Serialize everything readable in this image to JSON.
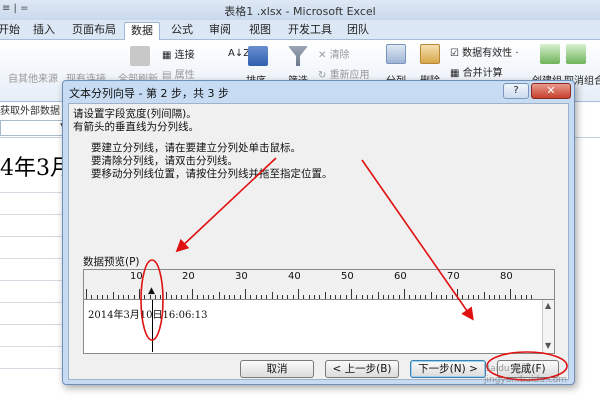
{
  "window": {
    "title": "表格1 .xlsx - Microsoft Excel",
    "quick_access": "≡ | ="
  },
  "menu": {
    "tabs": [
      "开始",
      "插入",
      "页面布局",
      "数据",
      "公式",
      "审阅",
      "视图",
      "开发工具",
      "团队"
    ],
    "active": "数据"
  },
  "ribbon": {
    "get_external": "自其他来源",
    "existing_conn": "现有连接",
    "refresh_all": "全部刷新",
    "connections": "连接",
    "properties": "属性",
    "sort": "排序",
    "filter": "筛选",
    "clear": "清除",
    "reapply": "重新应用",
    "text_to_cols": "分列",
    "remove_dup": "删除",
    "data_validation": "数据有效性 ·",
    "consolidate": "合并计算",
    "group": "创建组",
    "ungroup": "取消组合",
    "group_label": "获取外部数据",
    "sort_az": "A↓Z"
  },
  "sheet": {
    "cell_text": "4年3月"
  },
  "dialog": {
    "title": "文本分列向导 - 第 2 步，共 3 步",
    "help": "?",
    "close": "✕",
    "instructions": [
      "请设置字段宽度(列间隔)。",
      "有箭头的垂直线为分列线。"
    ],
    "steps": [
      "要建立分列线，请在要建立分列处单击鼠标。",
      "要清除分列线，请双击分列线。",
      "要移动分列线位置，请按住分列线并拖至指定位置。"
    ],
    "preview_label": "数据预览(P)",
    "ruler_labels": [
      "10",
      "20",
      "30",
      "40",
      "50",
      "60",
      "70",
      "80"
    ],
    "data_row": "2014年3月10日16:06:13",
    "buttons": {
      "cancel": "取消",
      "back": "< 上一步(B)",
      "next": "下一步(N) >",
      "finish": "完成(F)"
    }
  },
  "watermark": {
    "line1": "Baidu 经验",
    "line2": "jingyan.baidu.com"
  },
  "colors": {
    "annotation": "#e01010",
    "dialog_frame": "#c7dcf3"
  }
}
